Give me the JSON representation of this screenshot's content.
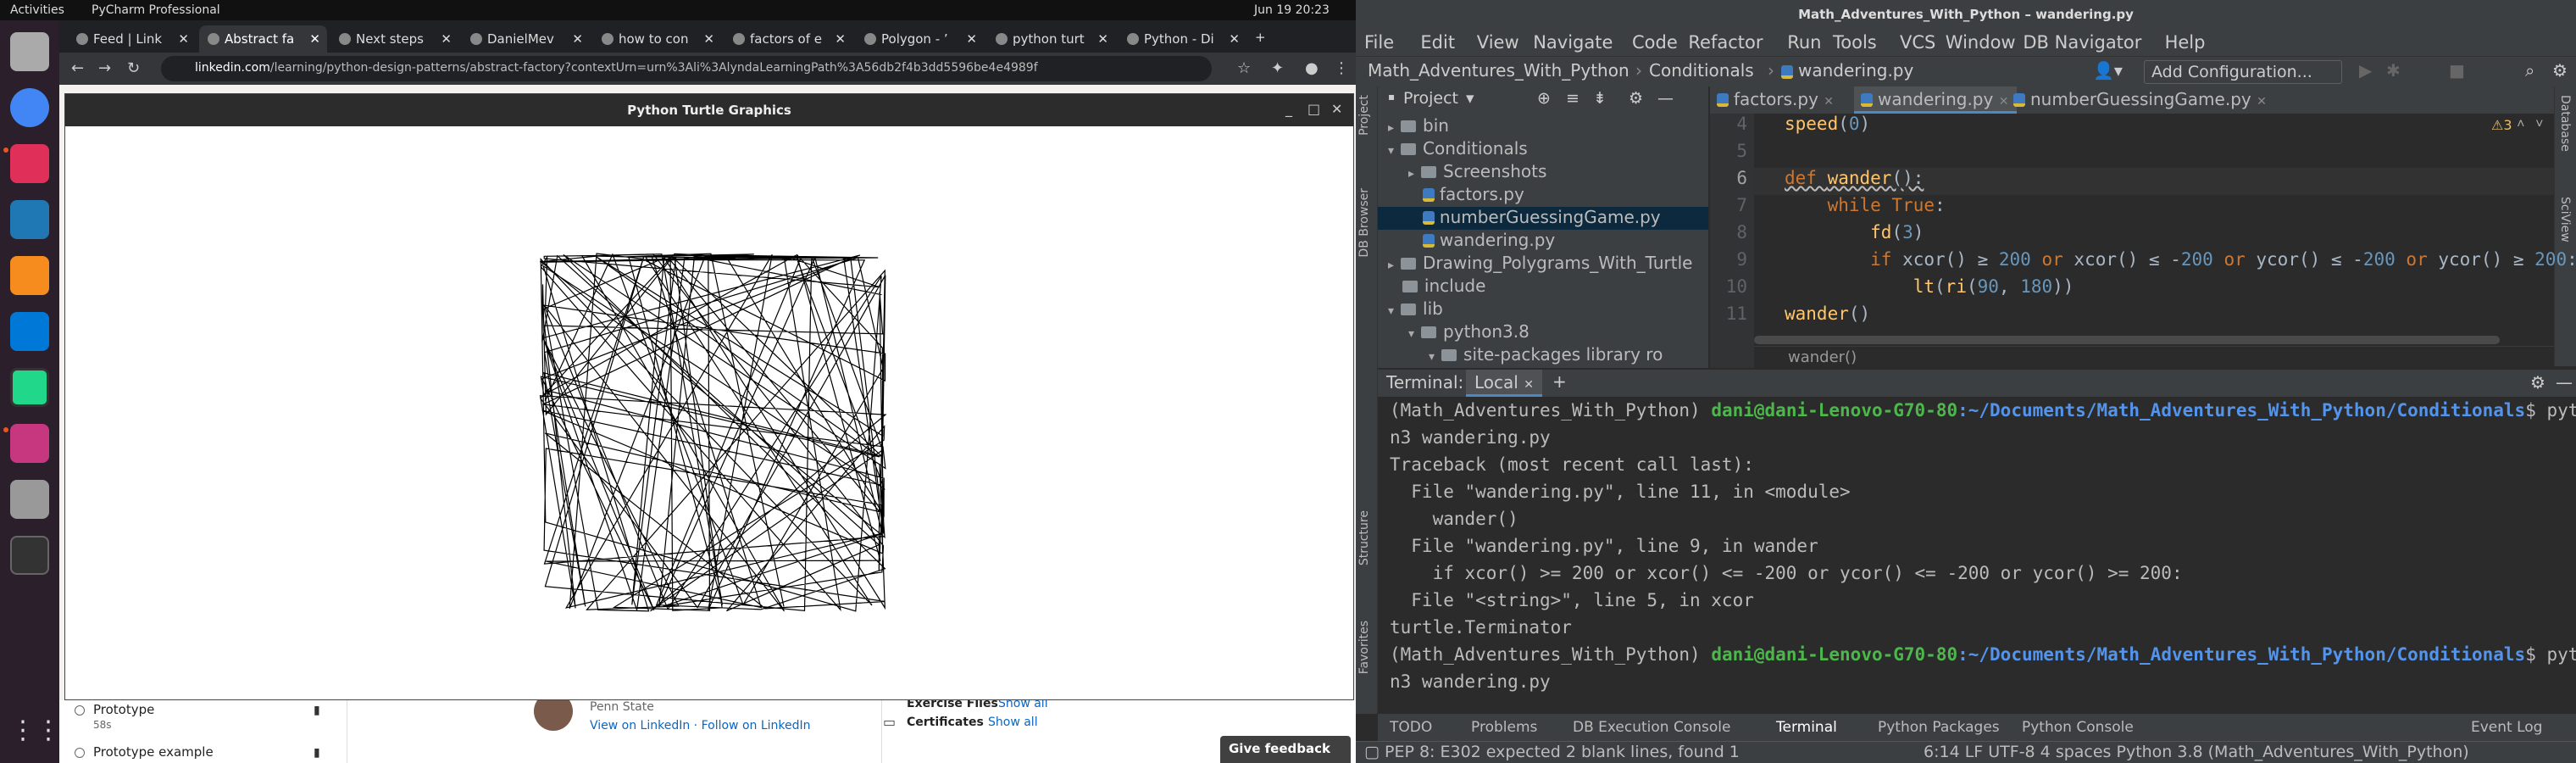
{
  "topbar": {
    "activities": "Activities",
    "app": "PyCharm Professional",
    "clock": "Jun 19  20:23"
  },
  "browser": {
    "tabs": [
      "Feed | Link",
      "Abstract fa",
      "Next steps",
      "DanielMev",
      "how to con",
      "factors of e",
      "Polygon - ’",
      "python turt",
      "Python - Di"
    ],
    "active_tab": 1,
    "url_host": "linkedin.com",
    "url_path": "/learning/python-design-patterns/abstract-factory?contextUrn=urn%3Ali%3AlyndaLearningPath%3A56db2f4b3dd5596be4e4989f",
    "sidebar": [
      {
        "title": "Prototype",
        "sub": "58s"
      },
      {
        "title": "Prototype example",
        "sub": ""
      }
    ],
    "author_school": "Penn State",
    "author_links": "View on LinkedIn · Follow on LinkedIn",
    "exercise_label": "Exercise Files",
    "show_all": "Show all",
    "certificates_label": "Certificates",
    "give_feedback": "Give feedback"
  },
  "turtle": {
    "title": "Python Turtle Graphics"
  },
  "ide": {
    "title": "Math_Adventures_With_Python – wandering.py",
    "menu": [
      "File",
      "Edit",
      "View",
      "Navigate",
      "Code",
      "Refactor",
      "Run",
      "Tools",
      "VCS",
      "Window",
      "DB Navigator",
      "Help"
    ],
    "breadcrumb": [
      "Math_Adventures_With_Python",
      "Conditionals",
      "wandering.py"
    ],
    "add_config": "Add Configuration...",
    "project_label": "Project",
    "tree": [
      {
        "label": "bin",
        "type": "folder",
        "depth": 0,
        "arrow": "▸"
      },
      {
        "label": "Conditionals",
        "type": "folder",
        "depth": 0,
        "arrow": "▾"
      },
      {
        "label": "Screenshots",
        "type": "folder",
        "depth": 1,
        "arrow": "▸"
      },
      {
        "label": "factors.py",
        "type": "py",
        "depth": 1,
        "arrow": ""
      },
      {
        "label": "numberGuessingGame.py",
        "type": "py",
        "depth": 1,
        "arrow": "",
        "selected": true
      },
      {
        "label": "wandering.py",
        "type": "py",
        "depth": 1,
        "arrow": ""
      },
      {
        "label": "Drawing_Polygrams_With_Turtle",
        "type": "folder",
        "depth": 0,
        "arrow": "▸"
      },
      {
        "label": "include",
        "type": "folder",
        "depth": 0,
        "arrow": ""
      },
      {
        "label": "lib",
        "type": "folder",
        "depth": 0,
        "arrow": "▾"
      },
      {
        "label": "python3.8",
        "type": "folder",
        "depth": 1,
        "arrow": "▾"
      },
      {
        "label": "site-packages  library ro",
        "type": "folder",
        "depth": 2,
        "arrow": "▾"
      }
    ],
    "editor_tabs": [
      "factors.py",
      "wandering.py",
      "numberGuessingGame.py"
    ],
    "active_editor_tab": 1,
    "line_numbers": [
      "4",
      "5",
      "6",
      "7",
      "8",
      "9",
      "10",
      "11"
    ],
    "inspection_count": "3",
    "breadcrumb_bottom": "wander()",
    "terminal_label": "Terminal:",
    "terminal_tab": "Local",
    "terminal": {
      "env": "(Math_Adventures_With_Python)",
      "user": "dani@dani-Lenovo-G70-80",
      "path": ":~/Documents/Math_Adventures_With_Python/Conditionals",
      "cmd1a": "$ pytho",
      "cmd1b": "n3 wandering.py",
      "lines": [
        "Traceback (most recent call last):",
        "  File \"wandering.py\", line 11, in <module>",
        "    wander()",
        "  File \"wandering.py\", line 9, in wander",
        "    if xcor() >= 200 or xcor() <= -200 or ycor() <= -200 or ycor() >= 200:",
        "  File \"<string>\", line 5, in xcor",
        "turtle.Terminator"
      ],
      "cmd2a": "$ pytho",
      "cmd2b": "n3 wandering.py"
    },
    "left_tools": [
      "Project",
      "DB Browser",
      "Structure",
      "Favorites"
    ],
    "right_tools": [
      "Database",
      "SciView"
    ],
    "bottom_tabs": [
      "TODO",
      "Problems",
      "DB Execution Console",
      "Terminal",
      "Python Packages",
      "Python Console",
      "Event Log"
    ],
    "status_msg": "PEP 8: E302 expected 2 blank lines, found 1",
    "status_right": "6:14  LF  UTF-8  4 spaces  Python 3.8 (Math_Adventures_With_Python)"
  }
}
